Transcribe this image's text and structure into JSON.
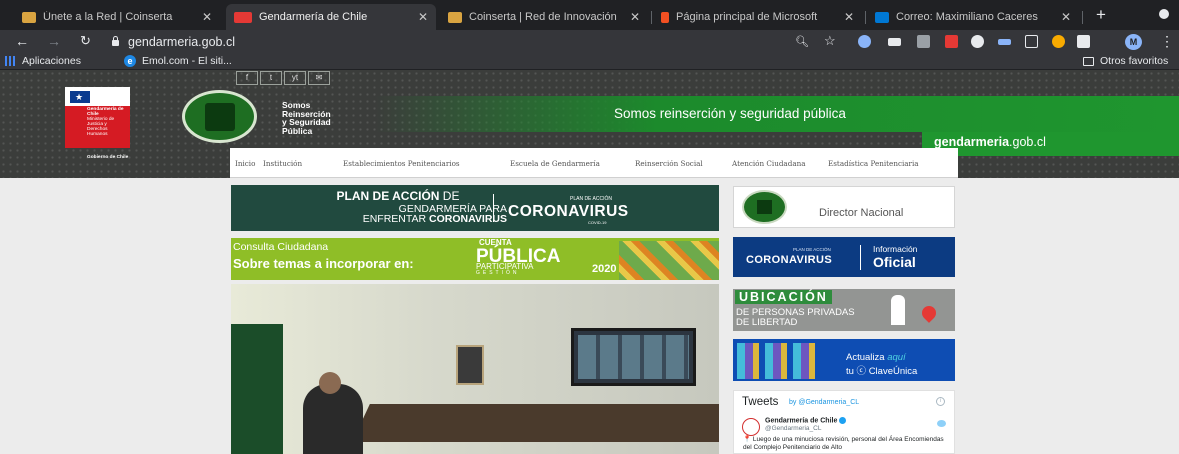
{
  "browser": {
    "tabs": [
      {
        "title": "Únete a la Red | Coinserta",
        "favicon_color": "#d9a441",
        "active": false
      },
      {
        "title": "Gendarmería de Chile",
        "favicon_color": "#e53935",
        "active": true
      },
      {
        "title": "Coinserta | Red de Innovación",
        "favicon_color": "#d9a441",
        "active": false
      },
      {
        "title": "Página principal de Microsoft",
        "favicon_color": "#f25022",
        "active": false
      },
      {
        "title": "Correo: Maximiliano Caceres",
        "favicon_color": "#0078d4",
        "active": false
      }
    ],
    "new_tab": "+",
    "url": "gendarmeria.gob.cl",
    "profile_initial": "M",
    "bookmarks": {
      "apps": "Aplicaciones",
      "emol": "Emol.com - El siti...",
      "other": "Otros favoritos"
    },
    "extension_colors": [
      "#8ab4f8",
      "#e8eaed",
      "#9aa0a6",
      "#e53935",
      "#e8eaed",
      "#8ab4f8",
      "#e8eaed",
      "#f9ab00",
      "#e8eaed"
    ]
  },
  "site": {
    "social": [
      "f",
      "t",
      "yt",
      "✉"
    ],
    "shield": {
      "title": "Gendarmería de Chile",
      "ministry": "Ministerio de Justicia y Derechos Humanos",
      "government": "Gobierno de Chile"
    },
    "tagline": [
      "Somos",
      "Reinserción",
      "y Seguridad",
      "Pública"
    ],
    "banner": "Somos reinserción y seguridad pública",
    "domain_bold": "gendarmeria",
    "domain_rest": ".gob.cl",
    "nav": [
      "Inicio",
      "Institución",
      "Establecimientos Penitenciarios",
      "Escuela de Gendarmería",
      "Reinserción Social",
      "Atención Ciudadana",
      "Estadística Penitenciaria"
    ],
    "plan_card": {
      "line1_bold": "PLAN DE ACCIÓN",
      "line1_rest": " DE",
      "line2": "GENDARMERÍA PARA",
      "line3_rest": "ENFRENTAR ",
      "line3_bold": "CORONAVIRUS",
      "small": "PLAN DE ACCIÓN",
      "big": "CORONAVIRUS",
      "sub": "COVID-19"
    },
    "consulta_card": {
      "line1": "Consulta Ciudadana",
      "line2": "Sobre temas a incorporar en:",
      "cp1": "CUENTA",
      "cp2": "PÚBLICA",
      "cp3": "PARTICIPATIVA",
      "cp4": "GESTIÓN",
      "year": "2020"
    },
    "director": {
      "label": "Director Nacional"
    },
    "covid_side": {
      "small": "PLAN DE ACCIÓN",
      "big": "CORONAVIRUS",
      "sub": "COVID-19",
      "info1": "Información",
      "info2": "Oficial"
    },
    "ubicacion": {
      "title": "UBICACIÓN",
      "line1": "DE PERSONAS PRIVADAS",
      "line2": "DE LIBERTAD"
    },
    "clave": {
      "line1_a": "Actualiza ",
      "line1_b": "aquí",
      "line2": "tu ⓒ ClaveÚnica"
    },
    "tweets": {
      "heading": "Tweets",
      "by": "by @Gendarmeria_CL",
      "info": "i",
      "name": "Gendarmería de Chile",
      "handle": "@Gendarmeria_CL",
      "text": "📍 Luego de una minuciosa revisión, personal del Área Encomiendas del Complejo Penitenciario de Alto"
    }
  }
}
